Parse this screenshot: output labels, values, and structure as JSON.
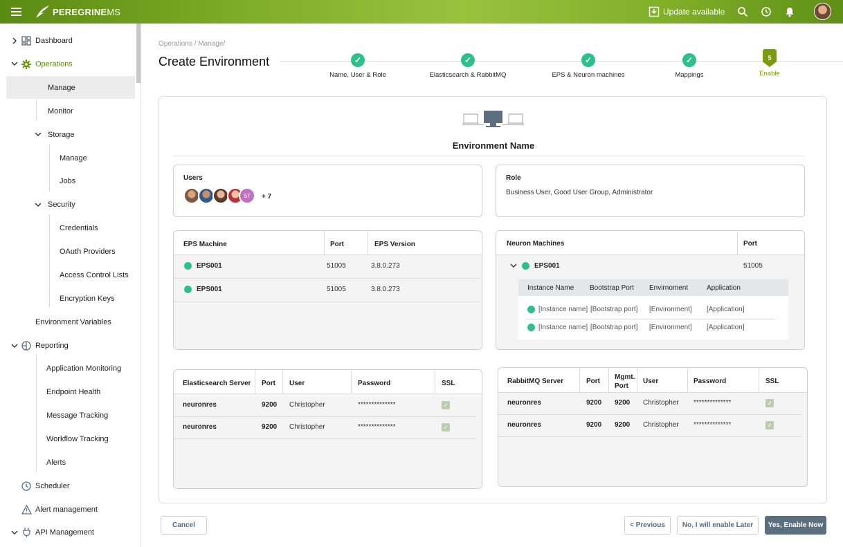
{
  "header": {
    "brand_bold": "PEREGRINE",
    "brand_light": "MS",
    "update_label": "Update available"
  },
  "sidebar": {
    "dashboard": "Dashboard",
    "operations": "Operations",
    "manage": "Manage",
    "monitor": "Monitor",
    "storage": "Storage",
    "storage_manage": "Manage",
    "jobs": "Jobs",
    "security": "Security",
    "credentials": "Credentials",
    "oauth": "OAuth Providers",
    "acl": "Access Control Lists",
    "enc_keys": "Encryption Keys",
    "env_vars": "Environment Variables",
    "reporting": "Reporting",
    "app_monitoring": "Application Monitoring",
    "endpoint_health": "Endpoint Health",
    "message_tracking": "Message Tracking",
    "workflow_tracking": "Workflow Tracking",
    "alerts": "Alerts",
    "scheduler": "Scheduler",
    "alert_mgmt": "Alert management",
    "api_mgmt": "API Management"
  },
  "breadcrumb": "Operations / Manage/",
  "page_title": "Create Environment",
  "steps": [
    {
      "label": "Name, User & Role"
    },
    {
      "label": "Elasticsearch & RabbitMQ"
    },
    {
      "label": "EPS & Neuron machines"
    },
    {
      "label": "Mappings"
    },
    {
      "label": "Enable",
      "number": "5"
    }
  ],
  "env_name": "Environment Name",
  "users": {
    "label": "Users",
    "avatar_initials": "ST",
    "more": "+ 7"
  },
  "role": {
    "label": "Role",
    "value": "Business User, Good User Group, Administrator"
  },
  "eps": {
    "headers": [
      "EPS Machine",
      "Port",
      "EPS Version"
    ],
    "rows": [
      {
        "name": "EPS001",
        "port": "51005",
        "version": "3.8.0.273"
      },
      {
        "name": "EPS001",
        "port": "51005",
        "version": "3.8.0.273"
      }
    ]
  },
  "neuron": {
    "headers": [
      "Neuron Machines",
      "Port"
    ],
    "machine": "EPS001",
    "port": "51005",
    "sub_headers": [
      "Instance Name",
      "Bootstrap Port",
      "Envirnoment",
      "Application"
    ],
    "sub_rows": [
      [
        "[Instance name]",
        "[Bootstrap port]",
        "[Environment]",
        "[Application]"
      ],
      [
        "[Instance name]",
        "[Bootstrap port]",
        "[Environment]",
        "[Application]"
      ]
    ]
  },
  "elastic": {
    "headers": [
      "Elasticsearch Server",
      "Port",
      "User",
      "Password",
      "SSL"
    ],
    "rows": [
      {
        "server": "neuronres",
        "port": "9200",
        "user": "Christopher",
        "password": "**************"
      },
      {
        "server": "neuronres",
        "port": "9200",
        "user": "Christopher",
        "password": "**************"
      }
    ]
  },
  "rabbit": {
    "headers": [
      "RabbitMQ Server",
      "Port",
      "Mgmt.",
      "Port",
      "User",
      "Password",
      "SSL"
    ],
    "rows": [
      {
        "server": "neuronres",
        "port": "9200",
        "mgmt": "9200",
        "user": "Christopher",
        "password": "**************"
      },
      {
        "server": "neuronres",
        "port": "9200",
        "mgmt": "9200",
        "user": "Christopher",
        "password": "**************"
      }
    ]
  },
  "buttons": {
    "cancel": "Cancel",
    "previous": "< Previous",
    "later": "No, I will enable Later",
    "enable": "Yes, Enable Now"
  },
  "colors": {
    "accent": "#7a9a10",
    "success": "#2fbf8a",
    "primary_button": "#5b6f7e"
  }
}
